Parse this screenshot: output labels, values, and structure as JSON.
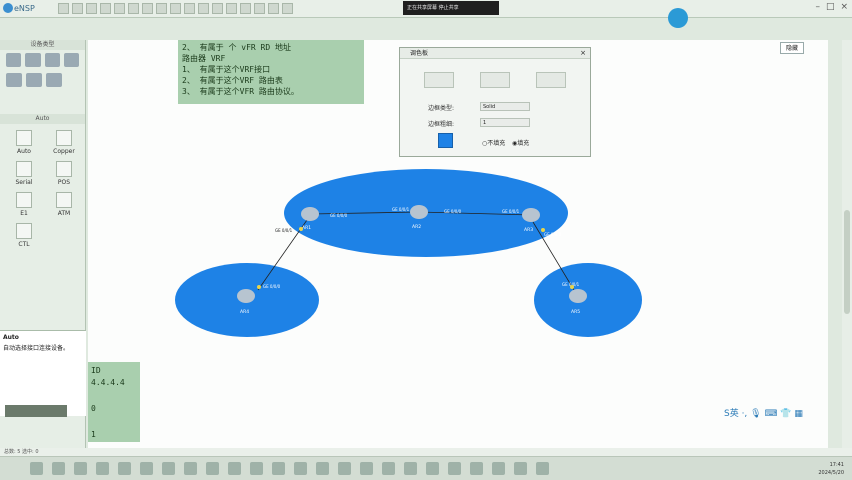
{
  "app": {
    "title": "eNSP",
    "recording_bar": "正在共享屏幕   停止共享",
    "hide_label": "隐藏"
  },
  "left_panel": {
    "device_title": "设备类型",
    "cable_title": "Auto",
    "cables": [
      {
        "label": "Auto",
        "icon": "lightning-icon"
      },
      {
        "label": "Copper",
        "icon": "cable-icon"
      },
      {
        "label": "Serial",
        "icon": "serial-icon"
      },
      {
        "label": "POS",
        "icon": "pos-icon"
      },
      {
        "label": "E1",
        "icon": "e1-icon"
      },
      {
        "label": "ATM",
        "icon": "atm-icon"
      },
      {
        "label": "CTL",
        "icon": "ctl-icon"
      }
    ],
    "auto_desc_title": "Auto",
    "auto_desc": "自动选择接口连接设备。"
  },
  "note": {
    "line0": "2、 有属于 个 vFR  RD 地址",
    "line1": "路由器 VRF",
    "line2": "  1、 有属于这个VRF接口",
    "line3": "  2、 有属于这个VRF 路由表",
    "line4": "  3、 有属于这个VFR 路由协议。"
  },
  "note2": {
    "line1": "ID 4.4.4.4",
    "line2": "0",
    "line3": "1"
  },
  "dialog": {
    "title": "调色板",
    "close": "×",
    "border_type_label": "边框类型:",
    "border_type_value": "Solid",
    "border_width_label": "边框粗细:",
    "border_width_value": "1",
    "radio_no_fill": "不填充",
    "radio_fill": "填充",
    "fill_color": "#1e82e6"
  },
  "topology": {
    "routers": [
      {
        "name": "AR1"
      },
      {
        "name": "AR2"
      },
      {
        "name": "AR3"
      },
      {
        "name": "AR4"
      },
      {
        "name": "AR5"
      }
    ],
    "interfaces": [
      "GE 0/0/1",
      "GE 0/0/0",
      "GE 0/0/1",
      "GE 0/0/0",
      "GE 0/0/1",
      "GE 0/0/0",
      "GE 0/0/0",
      "GE 0/0/1"
    ]
  },
  "status_bar": "总数: 5  选中: 0",
  "taskbar": {
    "time": "17:41",
    "date": "2024/5/20"
  },
  "sogou": "S英 ·, 🎙 ⌨ 👕 ▦"
}
